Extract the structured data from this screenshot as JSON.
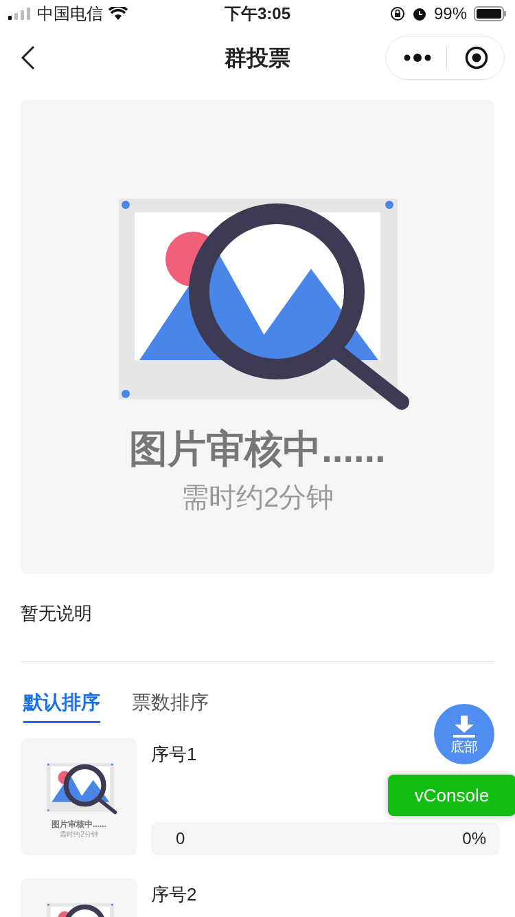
{
  "status_bar": {
    "carrier": "中国电信",
    "time": "下午3:05",
    "battery": "99%"
  },
  "nav": {
    "title": "群投票"
  },
  "cover": {
    "caption": "图片审核中......",
    "note": "需时约2分钟"
  },
  "description": "暂无说明",
  "tabs": [
    {
      "label": "默认排序",
      "selected": true
    },
    {
      "label": "票数排序",
      "selected": false
    }
  ],
  "items": [
    {
      "title": "序号1",
      "thumb": {
        "caption": "图片审核中......",
        "note": "需时约2分钟"
      },
      "votes": "0",
      "percent": "0%",
      "level": 0
    },
    {
      "title": "序号2"
    }
  ],
  "float_button": {
    "label": "底部"
  },
  "vconsole": {
    "label": "vConsole"
  }
}
